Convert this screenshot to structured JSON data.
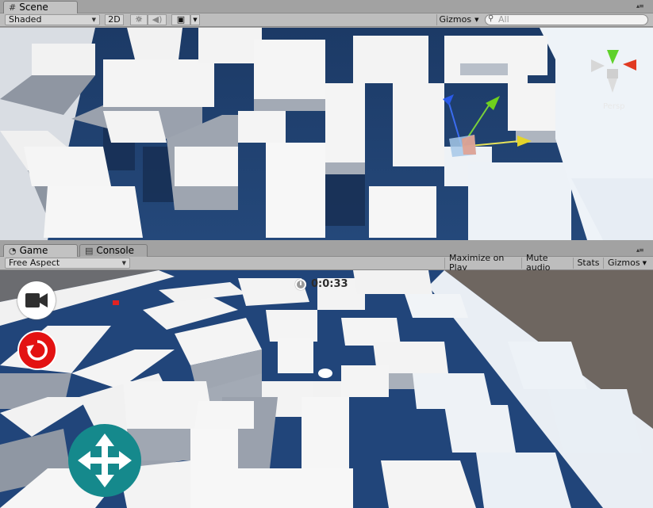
{
  "scene_panel": {
    "tab_label": "Scene",
    "shading_mode": "Shaded",
    "mode_2d_label": "2D",
    "gizmos_label": "Gizmos",
    "search_placeholder": "All",
    "orientation_label": "Persp"
  },
  "game_panel": {
    "tabs": [
      {
        "label": "Game",
        "icon": "pacman-icon"
      },
      {
        "label": "Console",
        "icon": "console-icon"
      }
    ],
    "aspect": "Free Aspect",
    "toolbar_buttons": [
      "Maximize on Play",
      "Mute audio",
      "Stats",
      "Gizmos"
    ],
    "timer_text": "0:0:33"
  },
  "colors": {
    "editor_background": "#a2a2a2",
    "maze_floor": "#1f4170",
    "block_top": "#f2f2f2",
    "restart_button": "#e31212",
    "move_pad": "#15898c"
  }
}
